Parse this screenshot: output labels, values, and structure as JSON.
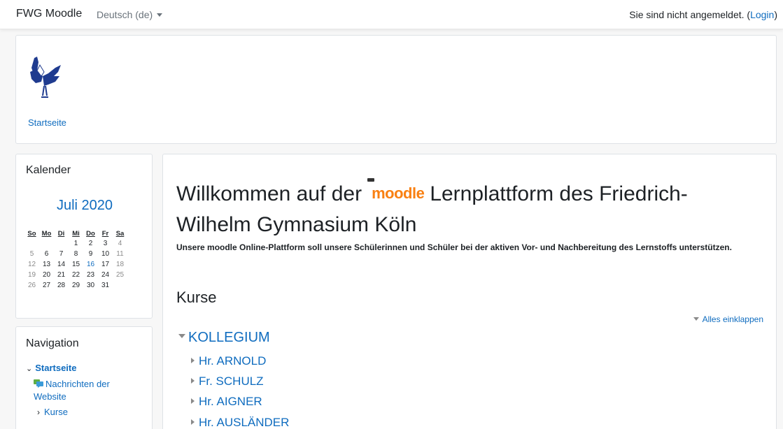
{
  "navbar": {
    "brand": "FWG Moodle",
    "language": "Deutsch (de)",
    "login_prefix": "Sie sind nicht angemeldet. (",
    "login_link": "Login",
    "login_suffix": ")"
  },
  "header": {
    "breadcrumb": "Startseite"
  },
  "calendar": {
    "title": "Kalender",
    "month": "Juli 2020",
    "weekdays": [
      "So",
      "Mo",
      "Di",
      "Mi",
      "Do",
      "Fr",
      "Sa"
    ],
    "weeks": [
      [
        "",
        "",
        "",
        "1",
        "2",
        "3",
        "4"
      ],
      [
        "5",
        "6",
        "7",
        "8",
        "9",
        "10",
        "11"
      ],
      [
        "12",
        "13",
        "14",
        "15",
        "16",
        "17",
        "18"
      ],
      [
        "19",
        "20",
        "21",
        "22",
        "23",
        "24",
        "25"
      ],
      [
        "26",
        "27",
        "28",
        "29",
        "30",
        "31",
        ""
      ]
    ],
    "today": "16"
  },
  "navigation": {
    "title": "Navigation",
    "home": "Startseite",
    "news_line1": "Nachrichten der",
    "news_line2": "Website",
    "courses": "Kurse"
  },
  "main": {
    "welcome_before": "Willkommen auf der",
    "moodle_logo_text": "moodle",
    "welcome_after": "Lernplattform des Friedrich-Wilhelm Gymnasium Köln",
    "intro": "Unsere moodle Online-Plattform soll unsere Schülerinnen und Schüler bei der aktiven Vor- und Nachbereitung des Lernstoffs unterstützen.",
    "courses_heading": "Kurse",
    "collapse_all": "Alles einklappen",
    "category_root": "KOLLEGIUM",
    "categories": [
      "Hr. ARNOLD",
      "Fr. SCHULZ",
      "Hr. AIGNER",
      "Hr. AUSLÄNDER"
    ]
  },
  "colors": {
    "link": "#0f6cbf",
    "moodle_orange": "#f98012",
    "weekend_gray": "#8a8a8a"
  }
}
